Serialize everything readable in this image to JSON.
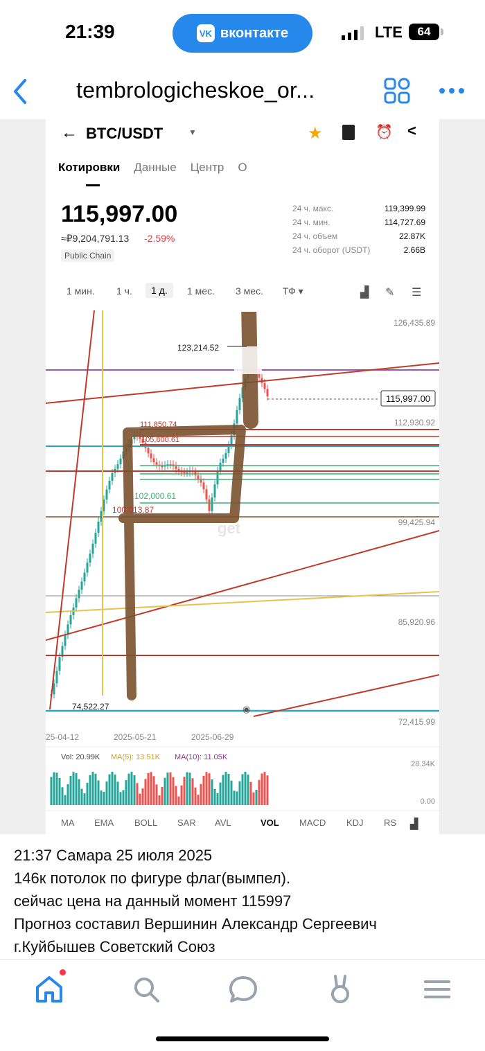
{
  "status": {
    "time": "21:39",
    "app_pill": "вконтакте",
    "vk_logo": "VK",
    "network": "LTE",
    "battery": "64"
  },
  "header": {
    "title": "tembrologicheskoe_or...",
    "back_icon": "chevron-left-icon",
    "grid_icon": "grid-icon",
    "more_icon": "more-dots-icon"
  },
  "screenshot": {
    "pair": "BTC/USDT",
    "tabs": [
      "Котировки",
      "Данные",
      "Центр",
      "О"
    ],
    "price": "115,997.00",
    "price_rub": "≈₽9,204,791.13",
    "change": "-2.59%",
    "chain_badge": "Public Chain",
    "stats": [
      {
        "label": "24 ч. макс.",
        "value": "119,399.99"
      },
      {
        "label": "24 ч. мин.",
        "value": "114,727.69"
      },
      {
        "label": "24 ч. объем",
        "value": "22.87K"
      },
      {
        "label": "24 ч. оборот (USDT)",
        "value": "2.66B"
      }
    ],
    "timeframes": [
      "1 мин.",
      "1 ч.",
      "1 д.",
      "1 мес.",
      "3 мес.",
      "ТФ ▾"
    ],
    "active_timeframe": "1 д.",
    "axis_labels": [
      "126,435.89",
      "112,930.92",
      "99,425.94",
      "85,920.96",
      "72,415.99"
    ],
    "price_tag": "115,997.00",
    "annotations": [
      "123,214.52",
      "111,850.74",
      "105,800.61",
      "102,000.61",
      "100,013.87",
      "74,522.27"
    ],
    "dates": [
      "25-04-12",
      "2025-05-21",
      "2025-06-29"
    ],
    "watermark": "get",
    "vol": {
      "vol": "Vol: 20.99K",
      "ma5": "MA(5): 13.51K",
      "ma10": "MA(10): 11.05K",
      "top": "28.34K",
      "bottom": "0.00"
    },
    "indicators": [
      "MA",
      "EMA",
      "BOLL",
      "SAR",
      "AVL",
      "VOL",
      "MACD",
      "KDJ",
      "RS"
    ],
    "active_indicator": "VOL",
    "colors": {
      "up": "#26a69a",
      "down": "#ef5350",
      "brown": "#7a5230",
      "red_line": "#c0392b",
      "purple": "#9b59b6",
      "yellow": "#e6c34a",
      "cyan": "#2aa7b8"
    }
  },
  "caption": [
    "21:37 Самара 25 июля 2025",
    "146к потолок по фигуре флаг(вымпел).",
    "сейчас цена на данный момент 115997",
    "Прогноз составил Вершинин Александр Сергеевич",
    "г.Куйбышев Советский Союз"
  ],
  "tabbar": [
    "home-icon",
    "search-icon",
    "messages-icon",
    "clips-icon",
    "menu-icon"
  ]
}
